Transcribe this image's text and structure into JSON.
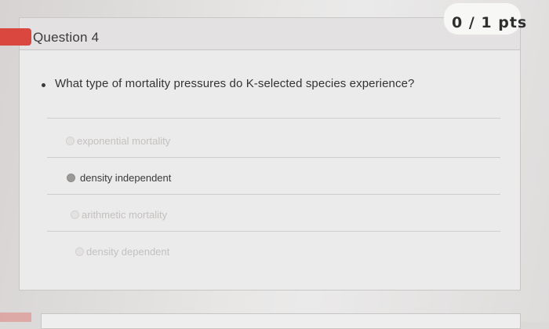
{
  "question": {
    "title": "Question 4",
    "points": "0 / 1 pts",
    "text": "What type of mortality pressures do K-selected species experience?"
  },
  "answers": [
    {
      "label": "exponential mortality",
      "selected": false
    },
    {
      "label": "density independent",
      "selected": true
    },
    {
      "label": "arithmetic mortality",
      "selected": false
    },
    {
      "label": "density dependent",
      "selected": false
    }
  ],
  "colors": {
    "accent_red": "#d9473e",
    "text_dark": "#333333",
    "text_faded": "#c3c1bf"
  }
}
